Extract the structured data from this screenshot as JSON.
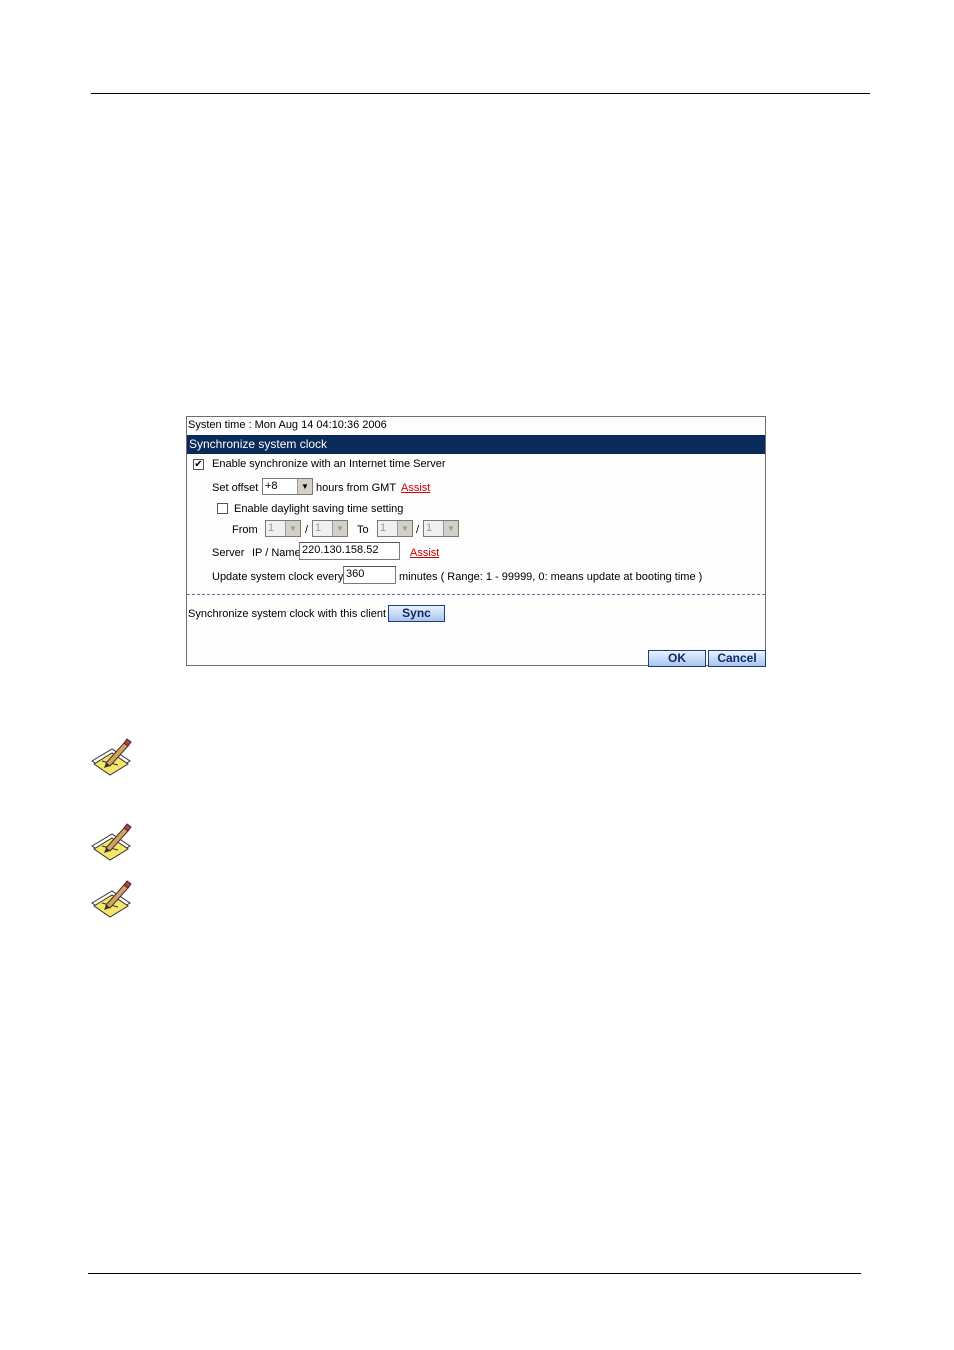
{
  "panel": {
    "system_time": "Systen time : Mon Aug 14 04:10:36 2006",
    "header": "Synchronize system clock",
    "enable_sync": {
      "label": "Enable synchronize with an Internet time Server",
      "checked": true
    },
    "offset": {
      "label": "Set offset",
      "value": "+8",
      "suffix": "hours from GMT",
      "assist": "Assist"
    },
    "daylight": {
      "label": "Enable daylight saving time setting",
      "checked": false,
      "from_label": "From",
      "to_label": "To",
      "sep": "/",
      "from_month": "1",
      "from_day": "1",
      "to_month": "1",
      "to_day": "1"
    },
    "server": {
      "label": "Server",
      "sublabel": "IP / Name",
      "value": "220.130.158.52",
      "assist": "Assist"
    },
    "update": {
      "label": "Update system clock every",
      "value": "360",
      "suffix": "minutes ( Range: 1 - 99999, 0: means update at booting time )"
    },
    "sync_client": {
      "label": "Synchronize system clock with this client",
      "button": "Sync"
    },
    "ok": "OK",
    "cancel": "Cancel"
  },
  "icons": [
    "note-pencil-icon",
    "note-pencil-icon",
    "note-pencil-icon"
  ]
}
